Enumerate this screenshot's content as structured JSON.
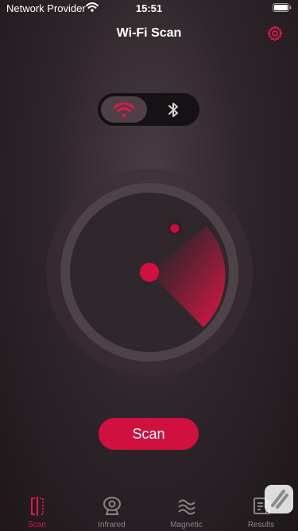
{
  "status_bar": {
    "carrier": "Network Provider",
    "time": "15:51"
  },
  "header": {
    "title": "Wi-Fi Scan",
    "settings_icon": "gear-icon"
  },
  "toggle": {
    "options": [
      {
        "id": "wifi",
        "icon": "wifi-icon",
        "selected": true
      },
      {
        "id": "bluetooth",
        "icon": "bluetooth-icon",
        "selected": false
      }
    ]
  },
  "radar": {
    "detected_signals": 1
  },
  "scan_button": {
    "label": "Scan"
  },
  "tabs": [
    {
      "label": "Scan",
      "icon": "scan-icon",
      "active": true
    },
    {
      "label": "Infrared",
      "icon": "camera-icon",
      "active": false
    },
    {
      "label": "Magnetic",
      "icon": "waves-icon",
      "active": false
    },
    {
      "label": "Results",
      "icon": "results-icon",
      "active": false
    }
  ],
  "colors": {
    "accent": "#d0103f",
    "background": "#2f262b",
    "inactive": "#8a8487"
  }
}
